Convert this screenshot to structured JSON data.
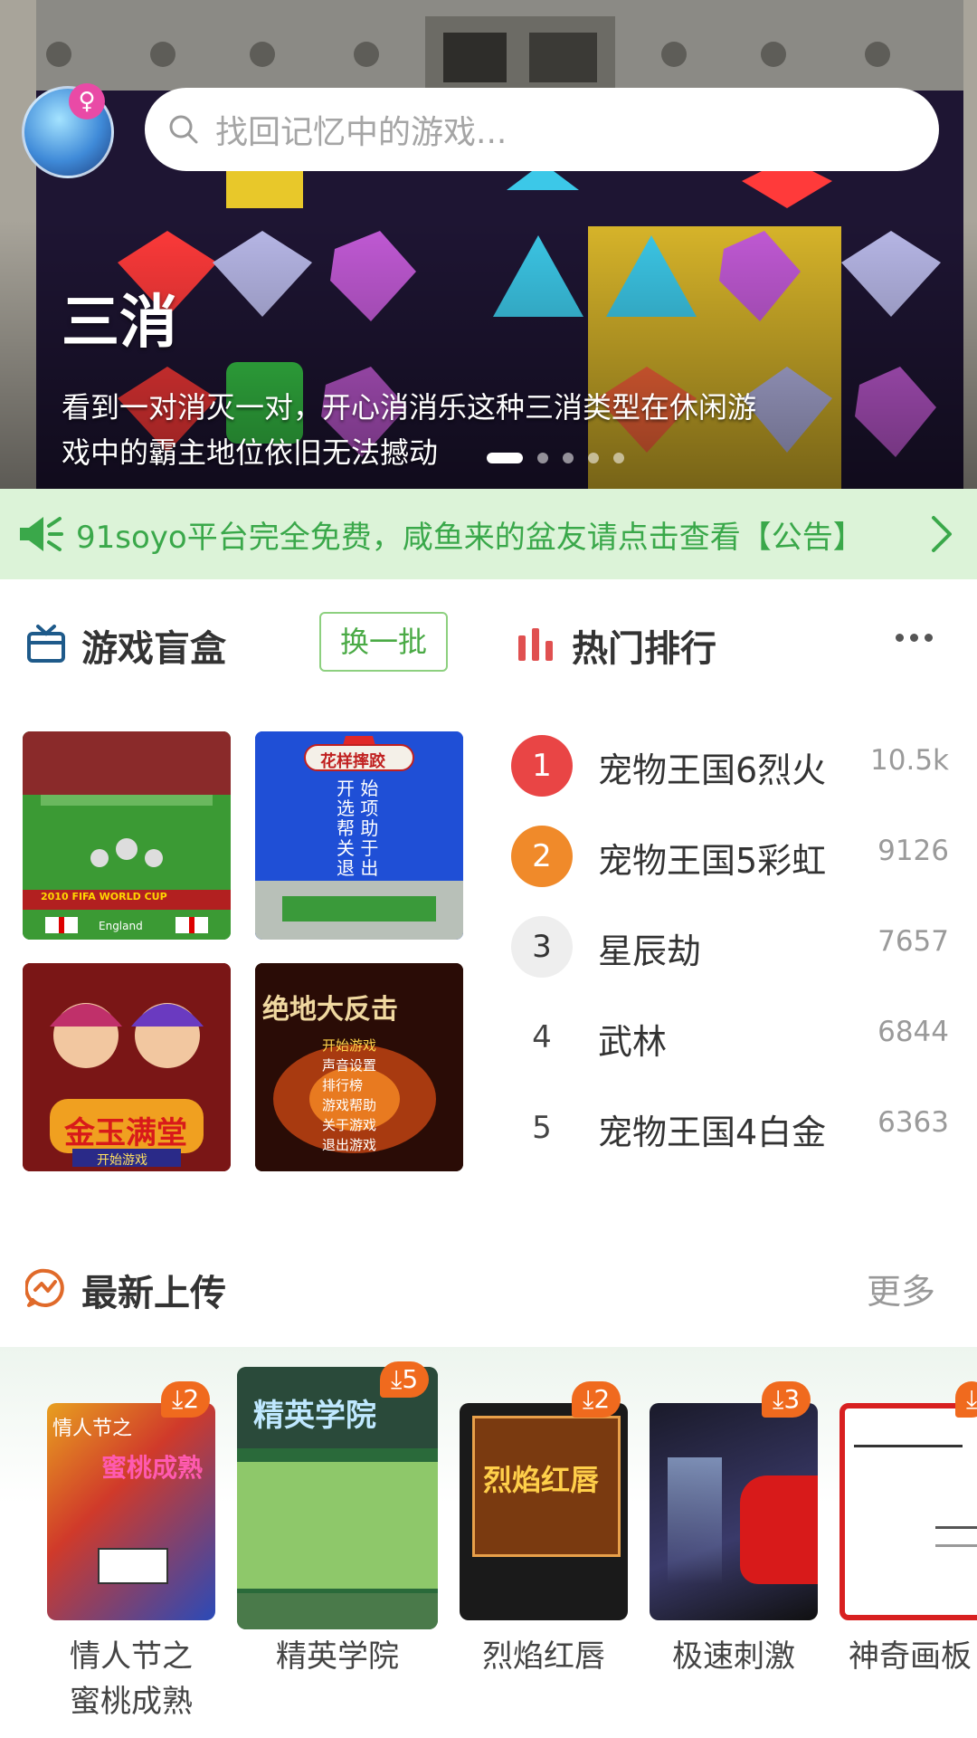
{
  "search": {
    "placeholder": "找回记忆中的游戏..."
  },
  "banner": {
    "title": "三消",
    "description": "看到一对消灭一对，开心消消乐这种三消类型在休闲游戏中的霸主地位依旧无法撼动",
    "dots_count": 5,
    "active_dot": 0
  },
  "notice": {
    "text": "91soyo平台完全免费，咸鱼来的盆友请点击查看【公告】"
  },
  "blind_box": {
    "title": "游戏盲盒",
    "swap_label": "换一批",
    "tiles": [
      {
        "caption": "2010 FIFA WORLD CUP",
        "sub": "England"
      },
      {
        "caption": "花样摔跤",
        "menu": [
          "开 始",
          "选 项",
          "帮 助",
          "关 于",
          "退 出"
        ]
      },
      {
        "caption": "金玉满堂",
        "sub": "开始游戏"
      },
      {
        "caption": "绝地大反击",
        "menu": [
          "开始游戏",
          "声音设置",
          "排行榜",
          "游戏帮助",
          "关于游戏",
          "退出游戏"
        ]
      }
    ]
  },
  "hot_rank": {
    "title": "热门排行",
    "items": [
      {
        "rank": "1",
        "name": "宠物王国6烈火",
        "count": "10.5k"
      },
      {
        "rank": "2",
        "name": "宠物王国5彩虹",
        "count": "9126"
      },
      {
        "rank": "3",
        "name": "星辰劫",
        "count": "7657"
      },
      {
        "rank": "4",
        "name": "武林",
        "count": "6844"
      },
      {
        "rank": "5",
        "name": "宠物王国4白金",
        "count": "6363"
      }
    ]
  },
  "newest": {
    "title": "最新上传",
    "more_label": "更多",
    "items": [
      {
        "name_line1": "情人节之",
        "name_line2": "蜜桃成熟",
        "downloads": "2"
      },
      {
        "name_line1": "精英学院",
        "name_line2": "",
        "downloads": "5"
      },
      {
        "name_line1": "烈焰红唇",
        "name_line2": "",
        "downloads": "2"
      },
      {
        "name_line1": "极速刺激",
        "name_line2": "",
        "downloads": "3"
      },
      {
        "name_line1": "神奇画板",
        "name_line2": "",
        "downloads": ""
      }
    ]
  },
  "colors": {
    "accent_green": "#3aa84a",
    "rank1": "#e94545",
    "rank2": "#f08a2a",
    "badge": "#f06a1e"
  }
}
